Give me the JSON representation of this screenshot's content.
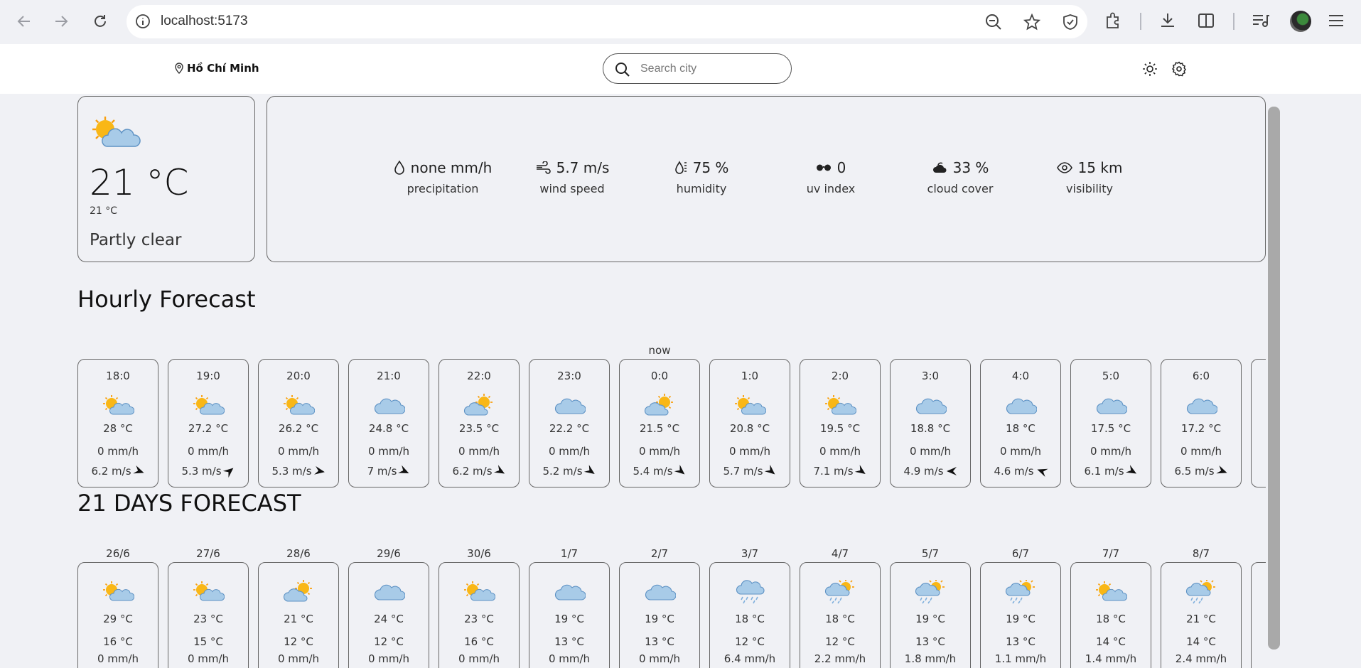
{
  "browser": {
    "url": "localhost:5173"
  },
  "header": {
    "location": "Hồ Chí Minh",
    "search_placeholder": "Search city"
  },
  "current": {
    "temperature": "21 °C",
    "feels_like": "21 °C",
    "condition": "Partly clear",
    "icon": "partly-cloudy-icon"
  },
  "metrics": [
    {
      "value": "none mm/h",
      "label": "precipitation",
      "icon": "droplet-icon"
    },
    {
      "value": "5.7 m/s",
      "label": "wind speed",
      "icon": "wind-icon"
    },
    {
      "value": "75 %",
      "label": "humidity",
      "icon": "humidity-icon"
    },
    {
      "value": "0",
      "label": "uv index",
      "icon": "sunglasses-icon"
    },
    {
      "value": "33 %",
      "label": "cloud cover",
      "icon": "cloud-icon"
    },
    {
      "value": "15 km",
      "label": "visibility",
      "icon": "eye-icon"
    }
  ],
  "hourly": {
    "title": "Hourly Forecast",
    "now_label": "now",
    "items": [
      {
        "time": "18:0",
        "icon": "partly-cloudy-icon",
        "temp": "28 °C",
        "precip": "0 mm/h",
        "wind": "6.2 m/s",
        "wind_dir": 200
      },
      {
        "time": "19:0",
        "icon": "partly-cloudy-icon",
        "temp": "27.2 °C",
        "precip": "0 mm/h",
        "wind": "5.3 m/s",
        "wind_dir": 140
      },
      {
        "time": "20:0",
        "icon": "partly-cloudy-icon",
        "temp": "26.2 °C",
        "precip": "0 mm/h",
        "wind": "5.3 m/s",
        "wind_dir": 190
      },
      {
        "time": "21:0",
        "icon": "cloudy-icon",
        "temp": "24.8 °C",
        "precip": "0 mm/h",
        "wind": "7 m/s",
        "wind_dir": 205
      },
      {
        "time": "22:0",
        "icon": "sun-behind-cloud-icon",
        "temp": "23.5 °C",
        "precip": "0 mm/h",
        "wind": "6.2 m/s",
        "wind_dir": 210
      },
      {
        "time": "23:0",
        "icon": "cloudy-icon",
        "temp": "22.2 °C",
        "precip": "0 mm/h",
        "wind": "5.2 m/s",
        "wind_dir": 215
      },
      {
        "time": "0:0",
        "icon": "sun-behind-cloud-icon",
        "temp": "21.5 °C",
        "precip": "0 mm/h",
        "wind": "5.4 m/s",
        "wind_dir": 220
      },
      {
        "time": "1:0",
        "icon": "partly-cloudy-icon",
        "temp": "20.8 °C",
        "precip": "0 mm/h",
        "wind": "5.7 m/s",
        "wind_dir": 220
      },
      {
        "time": "2:0",
        "icon": "partly-cloudy-icon",
        "temp": "19.5 °C",
        "precip": "0 mm/h",
        "wind": "7.1 m/s",
        "wind_dir": 215
      },
      {
        "time": "3:0",
        "icon": "cloudy-icon",
        "temp": "18.8 °C",
        "precip": "0 mm/h",
        "wind": "4.9 m/s",
        "wind_dir": 0
      },
      {
        "time": "4:0",
        "icon": "cloudy-icon",
        "temp": "18 °C",
        "precip": "0 mm/h",
        "wind": "4.6 m/s",
        "wind_dir": 20
      },
      {
        "time": "5:0",
        "icon": "cloudy-icon",
        "temp": "17.5 °C",
        "precip": "0 mm/h",
        "wind": "6.1 m/s",
        "wind_dir": 210
      },
      {
        "time": "6:0",
        "icon": "cloudy-icon",
        "temp": "17.2 °C",
        "precip": "0 mm/h",
        "wind": "6.5 m/s",
        "wind_dir": 200
      }
    ]
  },
  "daily": {
    "title": "21 DAYS FORECAST",
    "items": [
      {
        "date": "26/6",
        "icon": "partly-cloudy-icon",
        "max": "29 °C",
        "min": "16 °C",
        "precip": "0 mm/h"
      },
      {
        "date": "27/6",
        "icon": "partly-cloudy-icon",
        "max": "23 °C",
        "min": "15 °C",
        "precip": "0 mm/h"
      },
      {
        "date": "28/6",
        "icon": "sun-behind-cloud-icon",
        "max": "21 °C",
        "min": "12 °C",
        "precip": "0 mm/h"
      },
      {
        "date": "29/6",
        "icon": "cloudy-icon",
        "max": "24 °C",
        "min": "12 °C",
        "precip": "0 mm/h"
      },
      {
        "date": "30/6",
        "icon": "partly-cloudy-icon",
        "max": "23 °C",
        "min": "16 °C",
        "precip": "0 mm/h"
      },
      {
        "date": "1/7",
        "icon": "cloudy-icon",
        "max": "19 °C",
        "min": "13 °C",
        "precip": "0 mm/h"
      },
      {
        "date": "2/7",
        "icon": "cloudy-icon",
        "max": "19 °C",
        "min": "13 °C",
        "precip": "0 mm/h"
      },
      {
        "date": "3/7",
        "icon": "rain-cloud-icon",
        "max": "18 °C",
        "min": "12 °C",
        "precip": "6.4 mm/h"
      },
      {
        "date": "4/7",
        "icon": "sun-rain-cloud-icon",
        "max": "18 °C",
        "min": "12 °C",
        "precip": "2.2 mm/h"
      },
      {
        "date": "5/7",
        "icon": "sun-rain-cloud-icon",
        "max": "19 °C",
        "min": "13 °C",
        "precip": "1.8 mm/h"
      },
      {
        "date": "6/7",
        "icon": "sun-rain-cloud-icon",
        "max": "19 °C",
        "min": "13 °C",
        "precip": "1.1 mm/h"
      },
      {
        "date": "7/7",
        "icon": "partly-cloudy-icon",
        "max": "18 °C",
        "min": "14 °C",
        "precip": "1.4 mm/h"
      },
      {
        "date": "8/7",
        "icon": "sun-rain-cloud-icon",
        "max": "21 °C",
        "min": "14 °C",
        "precip": "2.4 mm/h"
      }
    ]
  }
}
